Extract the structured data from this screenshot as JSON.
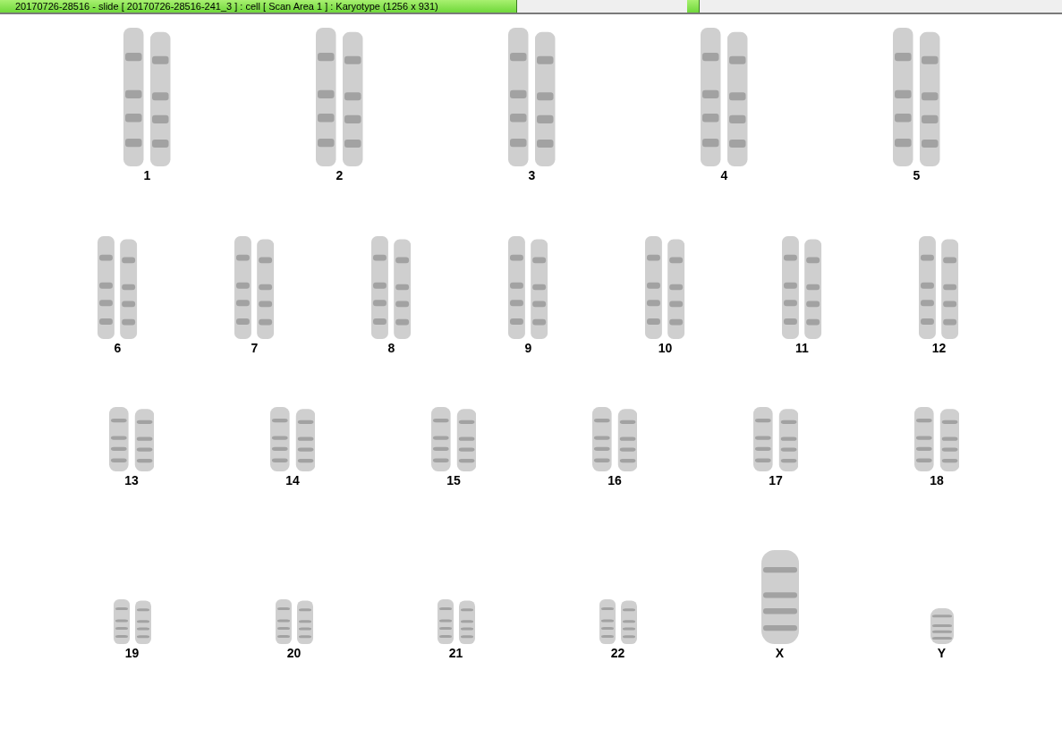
{
  "title_bar": {
    "title": "20170726-28516 - slide [ 20170726-28516-241_3 ] : cell [ Scan Area 1 ] : Karyotype  (1256 x 931)"
  },
  "karyotype": {
    "rows": [
      {
        "chromosomes": [
          {
            "label": "1",
            "kind": "pair"
          },
          {
            "label": "2",
            "kind": "pair"
          },
          {
            "label": "3",
            "kind": "pair"
          },
          {
            "label": "4",
            "kind": "pair"
          },
          {
            "label": "5",
            "kind": "pair"
          }
        ]
      },
      {
        "chromosomes": [
          {
            "label": "6",
            "kind": "pair"
          },
          {
            "label": "7",
            "kind": "pair"
          },
          {
            "label": "8",
            "kind": "pair"
          },
          {
            "label": "9",
            "kind": "pair"
          },
          {
            "label": "10",
            "kind": "pair"
          },
          {
            "label": "11",
            "kind": "pair"
          },
          {
            "label": "12",
            "kind": "pair"
          }
        ]
      },
      {
        "chromosomes": [
          {
            "label": "13",
            "kind": "pair"
          },
          {
            "label": "14",
            "kind": "pair"
          },
          {
            "label": "15",
            "kind": "pair"
          },
          {
            "label": "16",
            "kind": "pair"
          },
          {
            "label": "17",
            "kind": "pair"
          },
          {
            "label": "18",
            "kind": "pair"
          }
        ]
      },
      {
        "chromosomes": [
          {
            "label": "19",
            "kind": "pair"
          },
          {
            "label": "20",
            "kind": "pair"
          },
          {
            "label": "21",
            "kind": "pair"
          },
          {
            "label": "22",
            "kind": "pair"
          },
          {
            "label": "X",
            "kind": "single-tall"
          },
          {
            "label": "Y",
            "kind": "single-short"
          }
        ]
      }
    ]
  }
}
